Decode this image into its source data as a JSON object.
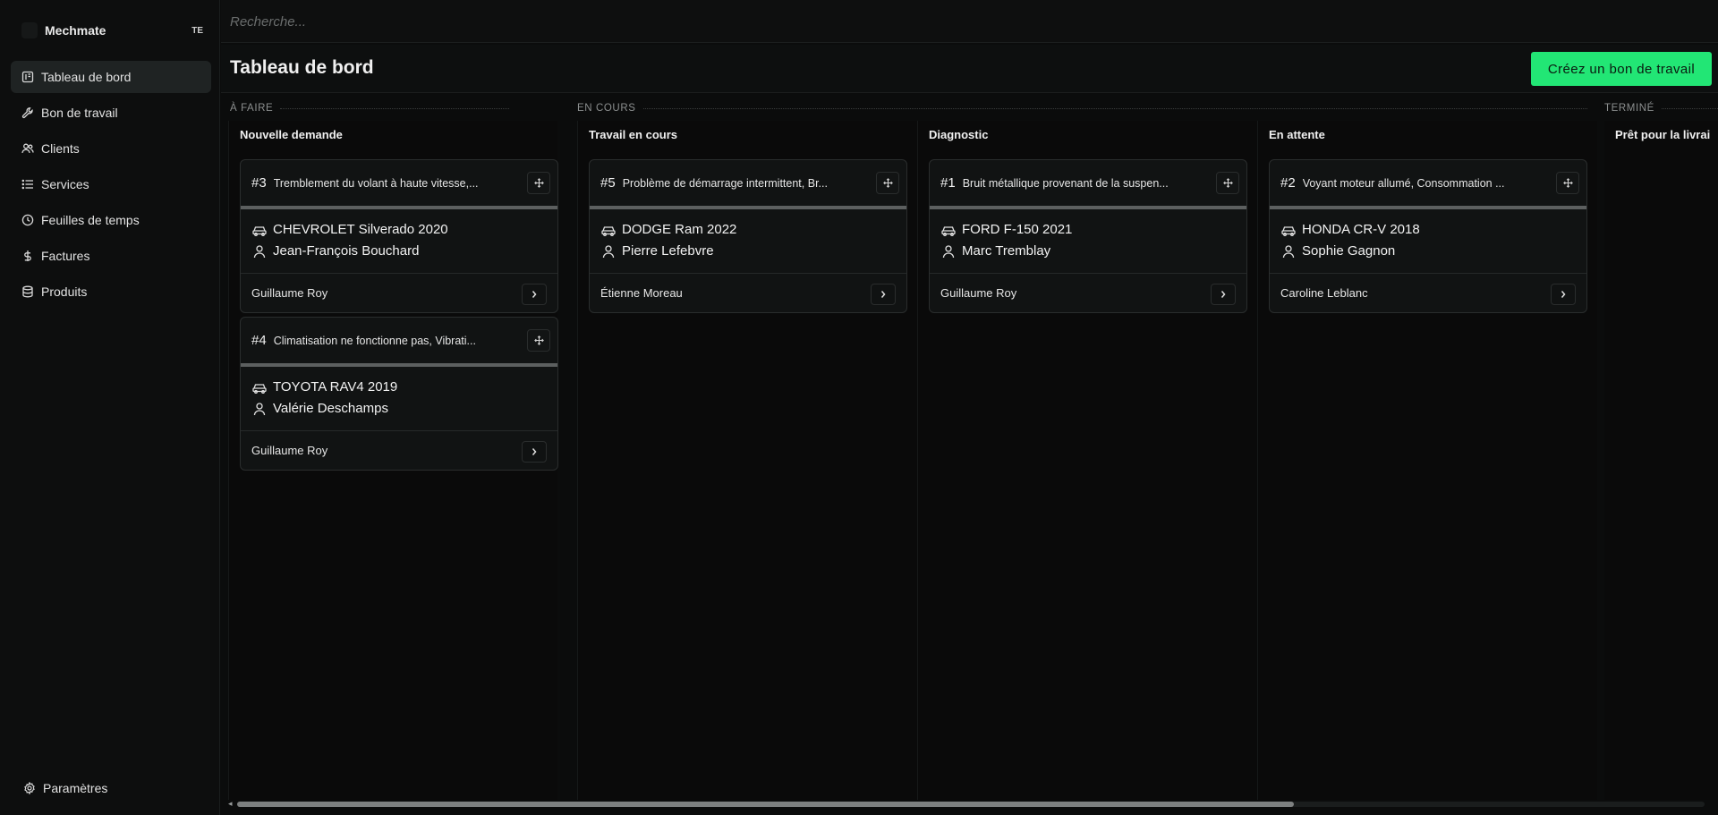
{
  "sidebar": {
    "brand": "Mechmate",
    "badge": "TE",
    "items": [
      {
        "label": "Tableau de bord",
        "icon": "dashboard-icon",
        "active": true
      },
      {
        "label": "Bon de travail",
        "icon": "wrench-icon"
      },
      {
        "label": "Clients",
        "icon": "users-icon"
      },
      {
        "label": "Services",
        "icon": "list-icon"
      },
      {
        "label": "Feuilles de temps",
        "icon": "clock-icon"
      },
      {
        "label": "Factures",
        "icon": "dollar-icon"
      },
      {
        "label": "Produits",
        "icon": "database-icon"
      }
    ],
    "settings_label": "Paramètres"
  },
  "search": {
    "placeholder": "Recherche..."
  },
  "header": {
    "title": "Tableau de bord",
    "create_label": "Créez un bon de travail"
  },
  "colors": {
    "accent": "#22e675",
    "background": "#0b0c0c",
    "card": "#111313"
  },
  "groups": [
    "À FAIRE",
    "EN COURS",
    "TERMINÉ"
  ],
  "columns": [
    {
      "title": "Nouvelle demande",
      "cards": [
        {
          "id": "#3",
          "description": "Tremblement du volant à haute vitesse,...",
          "vehicle": "CHEVROLET Silverado 2020",
          "client": "Jean-François Bouchard",
          "technician": "Guillaume Roy"
        },
        {
          "id": "#4",
          "description": "Climatisation ne fonctionne pas, Vibrati...",
          "vehicle": "TOYOTA RAV4 2019",
          "client": "Valérie Deschamps",
          "technician": "Guillaume Roy"
        }
      ]
    },
    {
      "title": "Travail en cours",
      "cards": [
        {
          "id": "#5",
          "description": "Problème de démarrage intermittent, Br...",
          "vehicle": "DODGE Ram 2022",
          "client": "Pierre Lefebvre",
          "technician": "Étienne Moreau"
        }
      ]
    },
    {
      "title": "Diagnostic",
      "cards": [
        {
          "id": "#1",
          "description": "Bruit métallique provenant de la suspen...",
          "vehicle": "FORD F-150 2021",
          "client": "Marc Tremblay",
          "technician": "Guillaume Roy"
        }
      ]
    },
    {
      "title": "En attente",
      "cards": [
        {
          "id": "#2",
          "description": "Voyant moteur allumé, Consommation ...",
          "vehicle": "HONDA CR-V 2018",
          "client": "Sophie Gagnon",
          "technician": "Caroline Leblanc"
        }
      ]
    },
    {
      "title": "Prêt pour la livrai",
      "cards": []
    }
  ]
}
